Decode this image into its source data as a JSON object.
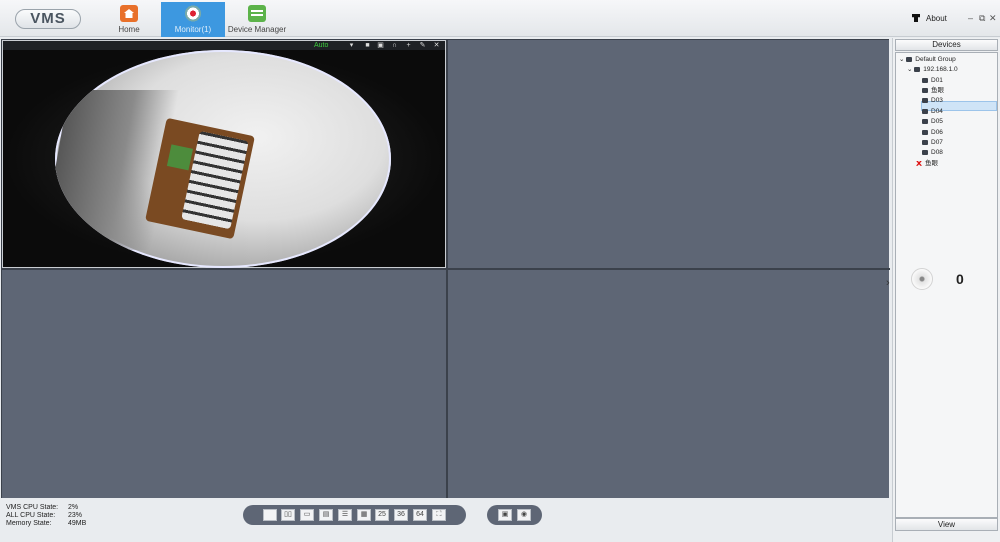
{
  "app": {
    "logo": "VMS"
  },
  "nav": [
    {
      "id": "home",
      "label": "Home",
      "icon": "home-icon"
    },
    {
      "id": "monitor",
      "label": "Monitor(1)",
      "icon": "camera-icon",
      "active": true
    },
    {
      "id": "device-manager",
      "label": "Device Manager",
      "icon": "device-manager-icon"
    }
  ],
  "header": {
    "about_label": "About",
    "minimize": "–",
    "restore": "⧉",
    "close": "✕"
  },
  "video": {
    "mode_label": "Auto",
    "toolbar_icons": [
      "dropdown-icon",
      "record-icon",
      "snapshot-icon",
      "audio-icon",
      "ptz-icon",
      "settings-icon",
      "close-icon"
    ]
  },
  "status": {
    "vms_cpu_label": "VMS CPU State:",
    "vms_cpu_value": "2%",
    "all_cpu_label": "ALL CPU State:",
    "all_cpu_value": "23%",
    "memory_label": "Memory State:",
    "memory_value": "49MB"
  },
  "layout_buttons": [
    "1",
    "4",
    "6",
    "8",
    "9",
    "16",
    "25",
    "36",
    "64",
    "fullscreen"
  ],
  "layout_labels": {
    "b25": "25",
    "b36": "36",
    "b64": "64"
  },
  "devices": {
    "header": "Devices",
    "group": "Default Group",
    "host": "192.168.1.0",
    "items": [
      "D01",
      "鱼眼",
      "D03",
      "D04",
      "D05",
      "D06",
      "D07",
      "D08"
    ],
    "offline_item": "鱼眼",
    "selected_index": 1
  },
  "ptz": {
    "count": "0"
  },
  "view_button": "View",
  "colors": {
    "accent": "#3d98e0",
    "pane_bg": "#5e6675",
    "mode_green": "#3dcc3d"
  }
}
